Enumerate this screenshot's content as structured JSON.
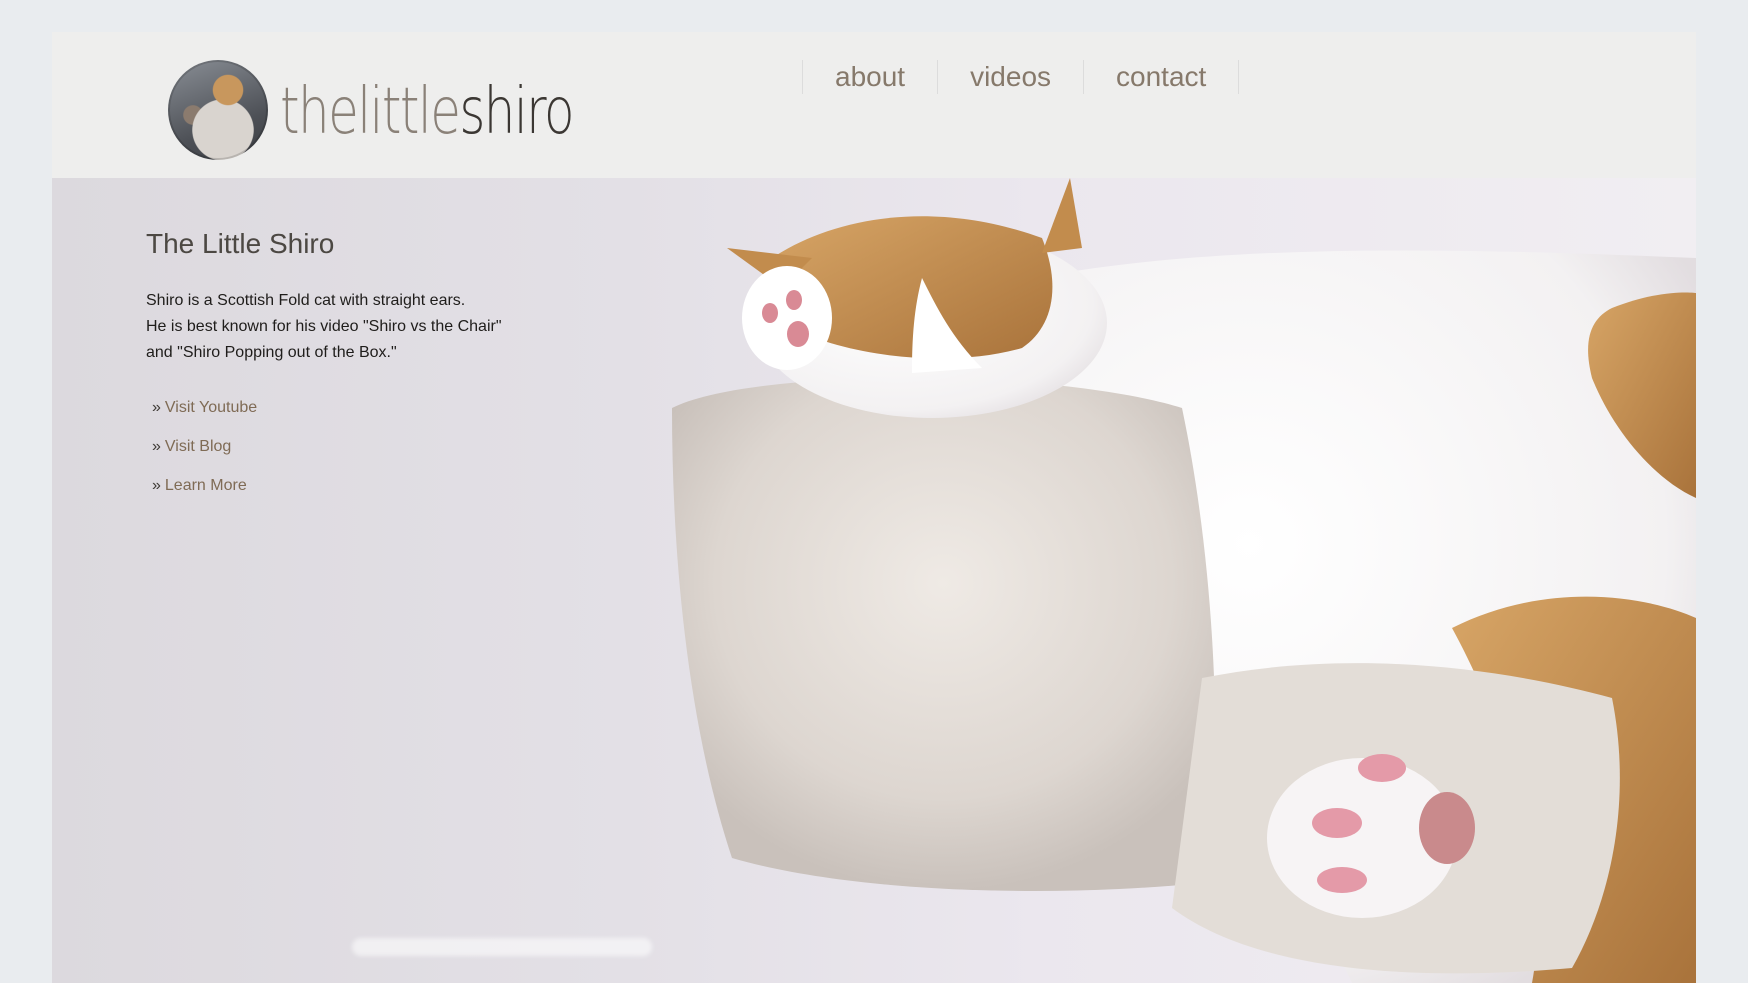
{
  "logo": {
    "text_light": "thelittle",
    "text_dark": "shiro"
  },
  "nav": {
    "items": [
      "about",
      "videos",
      "contact"
    ]
  },
  "hero": {
    "title": "The Little Shiro",
    "description": [
      "Shiro is a Scottish Fold cat with straight ears.",
      "He is best known for his video \"Shiro vs the Chair\"",
      "and \"Shiro Popping out of the Box.\""
    ],
    "link_prefix": "»",
    "links": [
      "Visit Youtube",
      "Visit Blog",
      "Learn More"
    ]
  },
  "colors": {
    "nav_text": "#86796b",
    "link_text": "#7f6b55",
    "title_text": "#4c4843",
    "header_bg": "#eeeeed",
    "page_bg": "#e9ecef"
  },
  "icons": [
    "cat-avatar-icon"
  ]
}
